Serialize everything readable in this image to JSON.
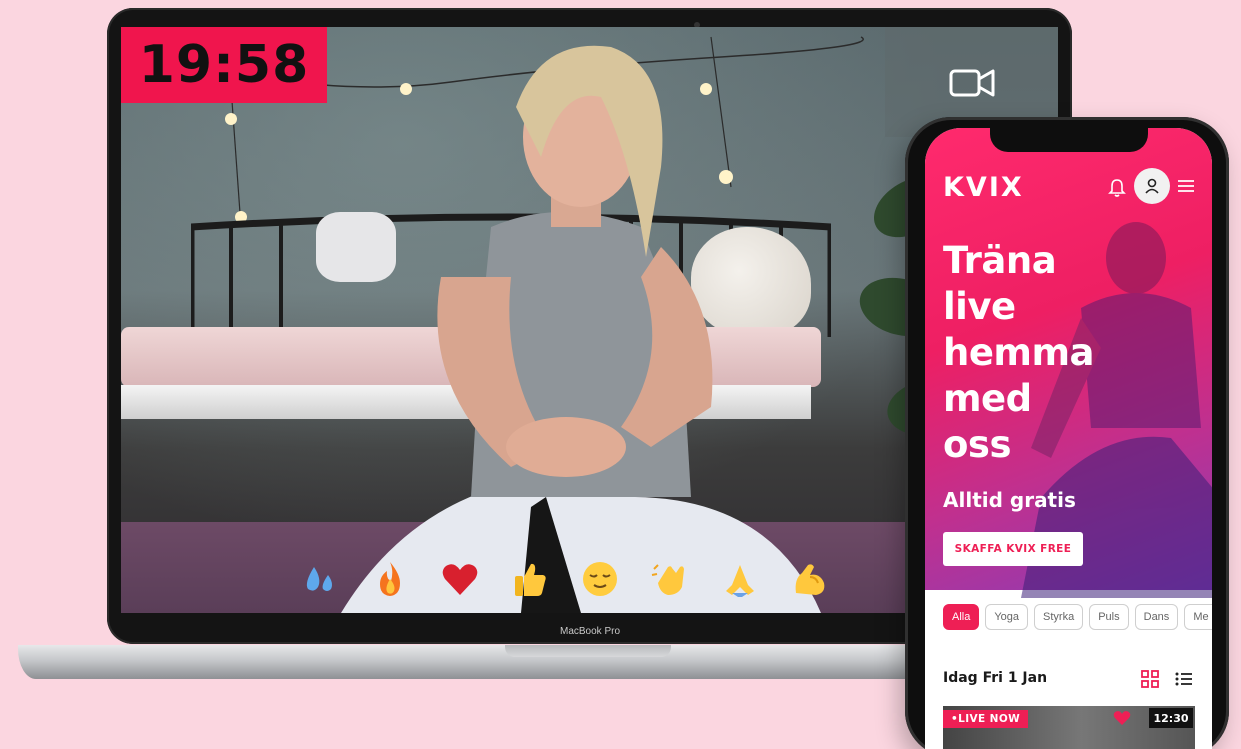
{
  "laptop": {
    "timer": "19:58",
    "model_label": "MacBook Pro",
    "video_icon": "video-camera-icon",
    "reactions": [
      "sweat-droplets-icon",
      "fire-icon",
      "red-heart-icon",
      "thumbs-up-icon",
      "relieved-face-icon",
      "clapping-hands-icon",
      "folded-hands-icon",
      "flexed-biceps-icon"
    ]
  },
  "phone": {
    "brand": "KVIX",
    "icons": {
      "bell": "bell-icon",
      "avatar": "user-icon",
      "menu": "hamburger-menu-icon"
    },
    "headline": [
      "Träna",
      "live",
      "hemma",
      "med",
      "oss"
    ],
    "subline": "Alltid gratis",
    "cta_label": "SKAFFA KVIX FREE",
    "filters": [
      "Alla",
      "Yoga",
      "Styrka",
      "Puls",
      "Dans",
      "Me"
    ],
    "active_filter": "Alla",
    "day_label": "Idag Fri 1 Jan",
    "card": {
      "live_label": "•LIVE NOW",
      "time": "12:30"
    }
  },
  "colors": {
    "accent": "#ee1f55",
    "timer_bg": "#f0154d",
    "background": "#fbd6e0"
  }
}
